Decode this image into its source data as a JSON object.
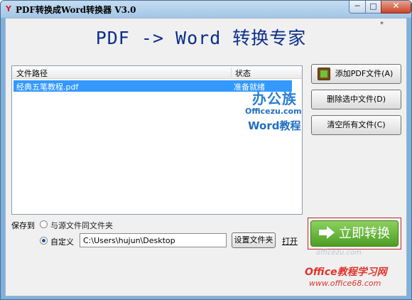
{
  "window": {
    "title": "PDF转换成Word转换器 V3.0",
    "app_icon": "Y",
    "minimize_label": "─",
    "maximize_label": "□",
    "close_label": "✕"
  },
  "header": {
    "title": "PDF -> Word 转换专家",
    "marker": "*"
  },
  "file_list": {
    "columns": [
      "文件路径",
      "状态"
    ],
    "rows": [
      {
        "name": "经典五笔教程.pdf",
        "status": "准备就绪",
        "selected": true
      }
    ]
  },
  "logo": {
    "brand_cn": "办公族",
    "brand_url": "Officezu.com",
    "brand_sub": "Word教程"
  },
  "actions": {
    "add_pdf": "添加PDF文件(A)",
    "remove_selected": "删除选中文件(D)",
    "clear_all": "清空所有文件(C)"
  },
  "save": {
    "label": "保存到",
    "option_same_folder": "与源文件同文件夹",
    "option_custom": "自定义",
    "selected_option": "custom",
    "path_value": "C:\\Users\\hujun\\Desktop",
    "set_folder_button": "设置文件夹",
    "open_link": "打开"
  },
  "convert": {
    "label": "立即转换"
  },
  "watermark": {
    "top": "officezu.com",
    "main": "Office教程学习网",
    "url": "www.office68.com"
  },
  "colors": {
    "accent": "#0c2e8c",
    "selection": "#3399ff",
    "convert_green": "#5fae32",
    "highlight_red": "#c02a2a"
  },
  "icons": [
    "app-icon",
    "add-pdf-icon",
    "arrow-right-icon"
  ]
}
